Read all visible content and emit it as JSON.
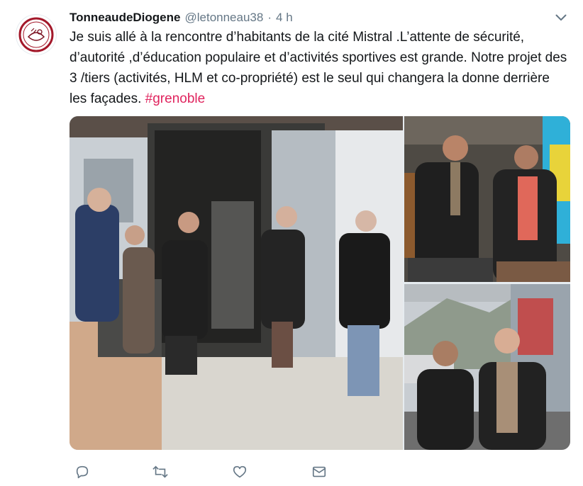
{
  "tweet": {
    "author_name": "TonneaudeDiogene",
    "handle": "@letonneau38",
    "separator": "·",
    "time": "4 h",
    "text": "Je suis allé à la rencontre d’habitants de la cité Mistral .L’attente de sécurité, d’autorité ,d’éducation populaire et d’activités sportives est grande. Notre projet des 3 /tiers (activités, HLM et co-propriété) est le seul qui changera la donne derrière les façades. ",
    "hashtag": "#grenoble"
  },
  "icons": {
    "avatar": "barrel-logo-icon",
    "menu": "chevron-down-icon",
    "reply": "reply-icon",
    "retweet": "retweet-icon",
    "like": "heart-icon",
    "message": "envelope-icon"
  },
  "colors": {
    "text": "#14171a",
    "secondary": "#657786",
    "hashtag": "#e0245e",
    "avatar_accent": "#a3182a"
  }
}
